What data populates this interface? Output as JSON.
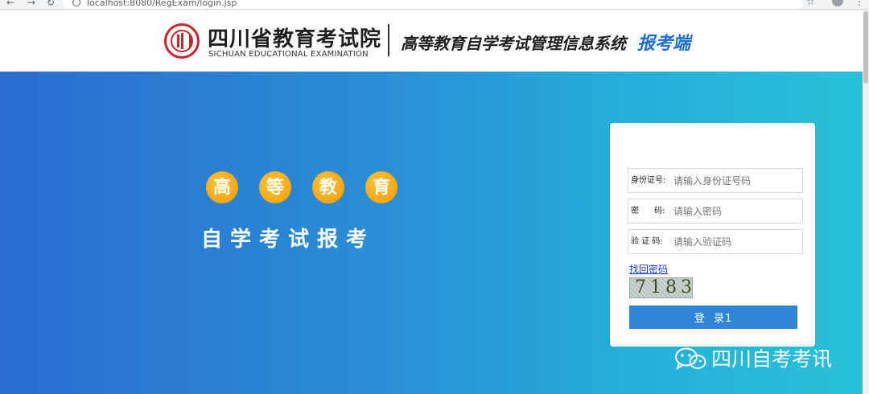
{
  "browser": {
    "back_glyph": "←",
    "forward_glyph": "→",
    "reload_glyph": "↻",
    "url": "localhost:8080/RegExam/login.jsp",
    "bookmark_glyph": "☆",
    "menu_glyph": "⋮"
  },
  "header": {
    "org_name": "四川省教育考试院",
    "org_name_en": "SICHUAN EDUCATIONAL EXAMINATION",
    "system_name": "高等教育自学考试管理信息系统",
    "client_label": "报考端",
    "brand_color": "#c8262c",
    "accent_color": "#1f6fd0"
  },
  "banner": {
    "circle_chars": [
      "高",
      "等",
      "教",
      "育"
    ],
    "slogan": "自学考试报考"
  },
  "login": {
    "id_label": "身份证号:",
    "id_placeholder": "请输入身份证号码",
    "password_label": "密      码:",
    "password_placeholder": "请输入密码",
    "captcha_label": "验 证 码:",
    "captcha_placeholder": "请输入验证码",
    "forgot_password": "找回密码",
    "captcha_code": "7183",
    "submit_label": "登  录1",
    "button_color": "#2f86d9"
  },
  "watermark": {
    "text": "四川自考考讯",
    "icon": "wechat-icon"
  }
}
